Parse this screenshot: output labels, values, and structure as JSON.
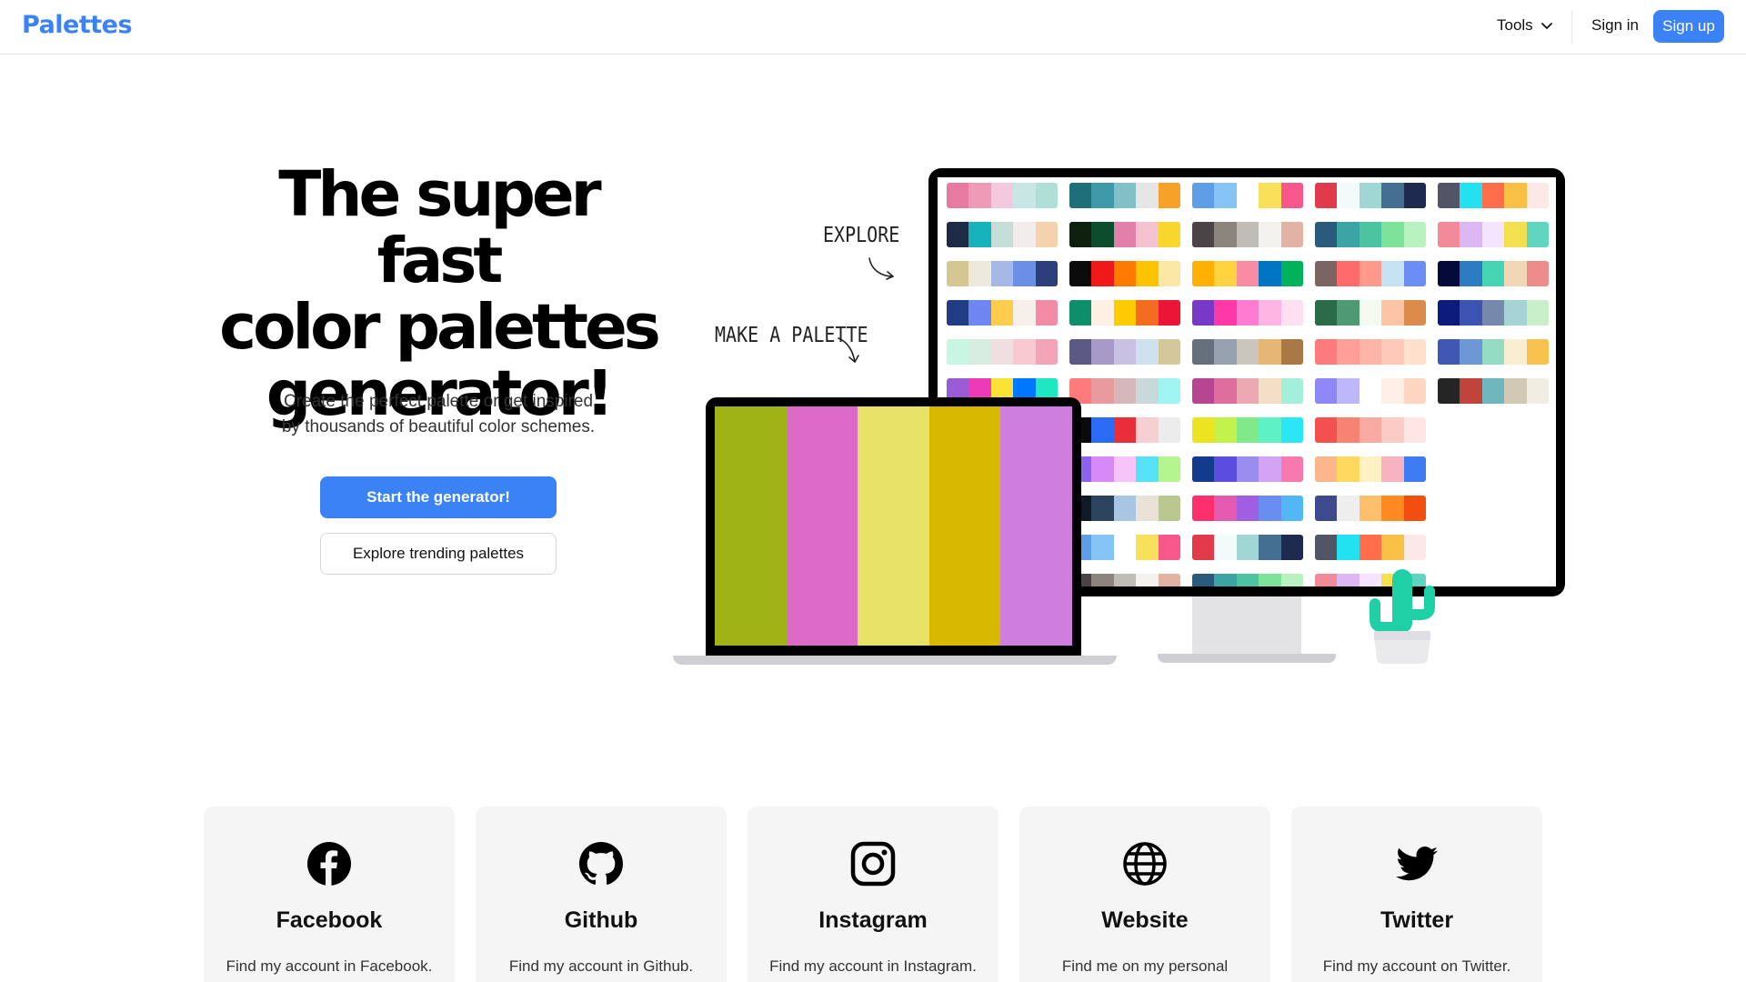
{
  "header": {
    "logo": "Palettes",
    "tools_label": "Tools",
    "signin_label": "Sign in",
    "signup_label": "Sign up"
  },
  "hero": {
    "title_line1": "The super fast",
    "title_line2": "color palettes",
    "title_line3": "generator!",
    "subtitle_line1": "Create the perfect palette or get inspired",
    "subtitle_line2": "by thousands of beautiful color schemes.",
    "primary_button": "Start the generator!",
    "secondary_button": "Explore trending palettes"
  },
  "illustration": {
    "note_explore": "EXPLORE",
    "note_make": "MAKE A PALETTE",
    "laptop_palette": [
      "#9fb317",
      "#dc6ac6",
      "#e6e366",
      "#d9b800",
      "#cf7ddf"
    ],
    "palette_grid": [
      [
        [
          "#e77aa0",
          "#ef9bb7",
          "#f4c8dd",
          "#c8e6e2",
          "#aee0d8"
        ],
        [
          "#1e6f7a",
          "#3e9aa9",
          "#7fc1c7",
          "#e6e6e6",
          "#f7a128"
        ],
        [
          "#5d9ee6",
          "#85c4f5",
          "#ffffff",
          "#f9e05a",
          "#f7578a"
        ],
        [
          "#e13a4a",
          "#f2fafa",
          "#a0d6d3",
          "#456f92",
          "#1e2a50"
        ],
        [
          "#525565",
          "#22e1f0",
          "#ff6d4a",
          "#f8c146",
          "#fde8e8"
        ]
      ],
      [
        [
          "#1e2b46",
          "#16b3bd",
          "#c7ddd7",
          "#f2ecec",
          "#f4d2ae"
        ],
        [
          "#0f1f0e",
          "#0d4c2c",
          "#e27fab",
          "#f5c2cf",
          "#f8d62b"
        ],
        [
          "#4b4446",
          "#8c857d",
          "#c0bdb6",
          "#f4f2ee",
          "#e2b3a2"
        ],
        [
          "#2b5b7c",
          "#3aa5a4",
          "#4cc4a0",
          "#7de29a",
          "#b8f2c1"
        ],
        [
          "#f28a9a",
          "#dbb8f4",
          "#f5e4ff",
          "#f3e04f",
          "#5fd7c0"
        ]
      ],
      [
        [
          "#d6c691",
          "#eeeadb",
          "#a6b9e6",
          "#6b8fe6",
          "#2d3f7a"
        ],
        [
          "#0b0b0b",
          "#f01818",
          "#ff7a00",
          "#ffc400",
          "#fbe7a6"
        ],
        [
          "#ffb000",
          "#ffd23f",
          "#f78ca2",
          "#0075c4",
          "#00b25a"
        ],
        [
          "#7a6563",
          "#ff6b6b",
          "#ff9a8c",
          "#c6e2f5",
          "#6b8ef5"
        ],
        [
          "#050a3a",
          "#2b7cc2",
          "#46d5b4",
          "#f2d7b6",
          "#ee8b8b"
        ]
      ],
      [
        [
          "#203c84",
          "#6f85f1",
          "#ffcc4d",
          "#f5f0ea",
          "#f38ba8"
        ],
        [
          "#0d8f6c",
          "#fff0e4",
          "#ffcc00",
          "#f36c21",
          "#ec1538"
        ],
        [
          "#7a38c7",
          "#ff38a8",
          "#ff7bd1",
          "#ffb5e3",
          "#ffdff0"
        ],
        [
          "#2a6b49",
          "#4f9a74",
          "#f5faf0",
          "#ffc3a6",
          "#dc8b4a"
        ],
        [
          "#0c1b7b",
          "#3d53b4",
          "#7589ad",
          "#a6d4d6",
          "#c9efc8"
        ]
      ],
      [
        [
          "#c8f6e2",
          "#d7ede0",
          "#f0dfe0",
          "#f8c9d0",
          "#f4a4b8"
        ],
        [
          "#5c5a84",
          "#a89ac8",
          "#c9c1e3",
          "#cfe0ee",
          "#d4c89a"
        ],
        [
          "#666f7c",
          "#96a1af",
          "#cbc6bd",
          "#e6b774",
          "#a87845"
        ],
        [
          "#ff7b7b",
          "#ff9e96",
          "#ffb4a8",
          "#ffc9ba",
          "#ffe0cc"
        ],
        [
          "#3f58b3",
          "#6d97d5",
          "#94dbc3",
          "#f9eed2",
          "#f8c24c"
        ]
      ],
      [
        [
          "#9c5bd6",
          "#ed3bb7",
          "#fbe235",
          "#0077ff",
          "#1ee8c2"
        ],
        [
          "#ff7b7b",
          "#e89a9e",
          "#d6b8ba",
          "#c9d9db",
          "#9ef5f2"
        ],
        [
          "#b84592",
          "#df6e9f",
          "#eca9b2",
          "#f3dfc5",
          "#a3efd9"
        ],
        [
          "#8f86f7",
          "#bcb8fb",
          "#ffffff",
          "#ffefe6",
          "#ffd6c2"
        ],
        [
          "#252525",
          "#c1443c",
          "#6fb7bf",
          "#d2c9b4",
          "#f2ede2"
        ]
      ],
      [
        [
          "#f8c94e",
          "#f5a21b",
          "#d3a61c",
          "#5b8a2e",
          "#16381b"
        ],
        [
          "#0a0a0a",
          "#2b6cf6",
          "#e92e39",
          "#f5cfd2",
          "#ececec"
        ],
        [
          "#ece321",
          "#c4f24d",
          "#80e989",
          "#5df1c4",
          "#2be6f5"
        ],
        [
          "#f4504f",
          "#f78373",
          "#f9aaa2",
          "#fbcbc6",
          "#fde6e4"
        ],
        [
          "#ffffff",
          "#ffffff",
          "#ffffff",
          "#ffffff",
          "#ffffff"
        ]
      ],
      [
        [
          "#1e50d8",
          "#1e97f7",
          "#94cdf6",
          "#fff6a2",
          "#ffd400"
        ],
        [
          "#8b63ee",
          "#d78af7",
          "#f7c4f9",
          "#57e1f6",
          "#b5f58f"
        ],
        [
          "#123b8b",
          "#5b4de0",
          "#9b8df0",
          "#d1a3f2",
          "#f779ad"
        ],
        [
          "#fbb78b",
          "#ffd95e",
          "#fff1c5",
          "#f8b2c0",
          "#3e7cf3"
        ],
        [
          "#ffffff",
          "#ffffff",
          "#ffffff",
          "#ffffff",
          "#ffffff"
        ]
      ],
      [
        [
          "#7f4f3a",
          "#c9a38a",
          "#fcd5bd",
          "#f7f0f8",
          "#b39ddb"
        ],
        [
          "#0f1a24",
          "#2c4460",
          "#a6c6e3",
          "#eae2d6",
          "#b9c88e"
        ],
        [
          "#ff2f6d",
          "#e45ab0",
          "#a05ee3",
          "#6a8df1",
          "#52b7f4"
        ],
        [
          "#3f4a8c",
          "#eeeeee",
          "#ffbf6b",
          "#ff8a1f",
          "#f24e0f"
        ],
        [
          "#ffffff",
          "#ffffff",
          "#ffffff",
          "#ffffff",
          "#ffffff"
        ]
      ],
      [
        [
          "#1e6f7a",
          "#3e9aa9",
          "#7fc1c7",
          "#e6e6e6",
          "#f7a128"
        ],
        [
          "#5d9ee6",
          "#85c4f5",
          "#ffffff",
          "#f9e05a",
          "#f7578a"
        ],
        [
          "#e13a4a",
          "#f2fafa",
          "#a0d6d3",
          "#456f92",
          "#1e2a50"
        ],
        [
          "#525565",
          "#22e1f0",
          "#ff6d4a",
          "#f8c146",
          "#fde8e8"
        ],
        [
          "#ffffff",
          "#ffffff",
          "#ffffff",
          "#ffffff",
          "#ffffff"
        ]
      ],
      [
        [
          "#0f1f0e",
          "#0d4c2c",
          "#e27fab",
          "#f5c2cf",
          "#f8d62b"
        ],
        [
          "#4b4446",
          "#8c857d",
          "#c0bdb6",
          "#f4f2ee",
          "#e2b3a2"
        ],
        [
          "#2b5b7c",
          "#3aa5a4",
          "#4cc4a0",
          "#7de29a",
          "#b8f2c1"
        ],
        [
          "#f28a9a",
          "#dbb8f4",
          "#f5e4ff",
          "#f3e04f",
          "#5fd7c0"
        ],
        [
          "#ffffff",
          "#ffffff",
          "#ffffff",
          "#ffffff",
          "#ffffff"
        ]
      ]
    ]
  },
  "cards": [
    {
      "title": "Facebook",
      "desc": "Find my account in Facebook.",
      "icon": "facebook-icon"
    },
    {
      "title": "Github",
      "desc": "Find my account in Github.",
      "icon": "github-icon"
    },
    {
      "title": "Instagram",
      "desc": "Find my account in Instagram.",
      "icon": "instagram-icon"
    },
    {
      "title": "Website",
      "desc": "Find me on my personal",
      "icon": "globe-icon"
    },
    {
      "title": "Twitter",
      "desc": "Find my account on Twitter.",
      "icon": "twitter-icon"
    }
  ],
  "colors": {
    "accent": "#3b82f6",
    "cactus": "#1fcfa6",
    "card_bg": "#f5f5f5"
  }
}
